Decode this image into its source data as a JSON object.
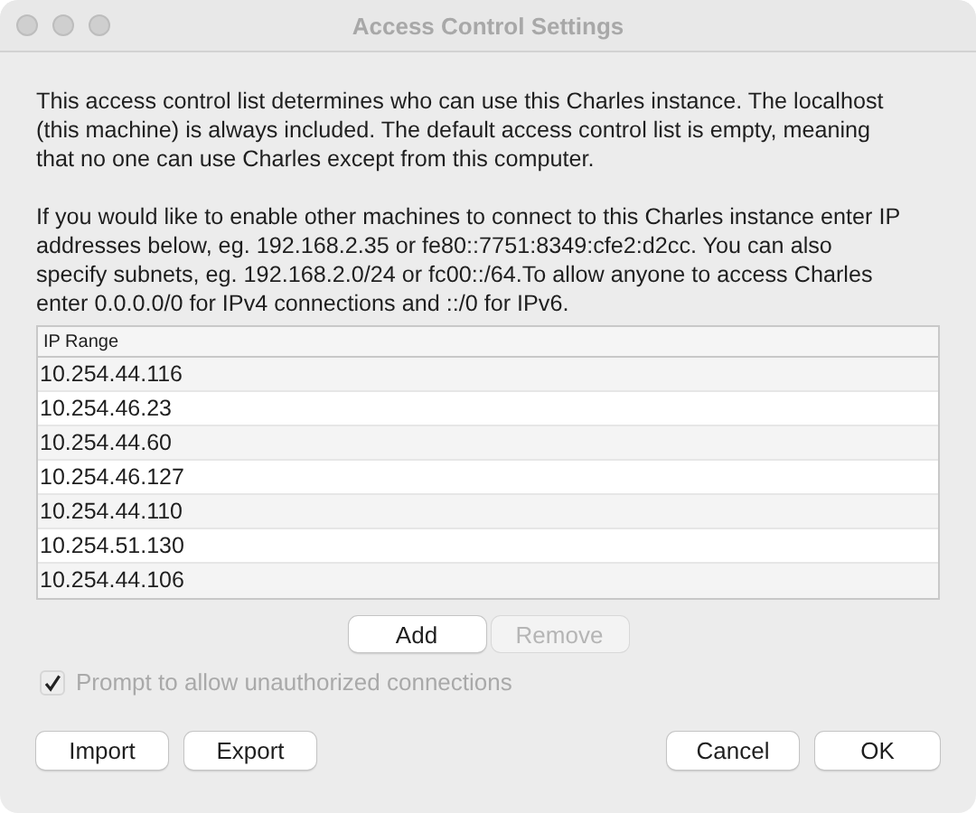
{
  "window": {
    "title": "Access Control Settings"
  },
  "paragraphs": [
    "This access control list determines who can use this Charles instance. The localhost (this machine) is always included. The default access control list is empty, meaning that no one can use Charles except from this computer.",
    "If you would like to enable other machines to connect to this Charles instance enter IP addresses below, eg. 192.168.2.35 or fe80::7751:8349:cfe2:d2cc. You can also specify subnets, eg. 192.168.2.0/24 or fc00::/64.To allow anyone to access Charles enter 0.0.0.0/0 for IPv4 connections and ::/0 for IPv6."
  ],
  "table": {
    "columns": [
      "IP Range"
    ],
    "rows": [
      {
        "ip": "10.254.44.116"
      },
      {
        "ip": "10.254.46.23"
      },
      {
        "ip": "10.254.44.60"
      },
      {
        "ip": "10.254.46.127"
      },
      {
        "ip": "10.254.44.110"
      },
      {
        "ip": "10.254.51.130"
      },
      {
        "ip": "10.254.44.106"
      }
    ]
  },
  "list_buttons": [
    {
      "label": "Add",
      "disabled": false
    },
    {
      "label": "Remove",
      "disabled": true
    }
  ],
  "prompt_checkbox": {
    "label": "Prompt to allow unauthorized connections",
    "checked": true,
    "disabled": true
  },
  "left_buttons": [
    {
      "label": "Import",
      "disabled": false
    },
    {
      "label": "Export",
      "disabled": false
    }
  ],
  "right_buttons": [
    {
      "label": "Cancel",
      "disabled": false
    },
    {
      "label": "OK",
      "disabled": false
    }
  ]
}
